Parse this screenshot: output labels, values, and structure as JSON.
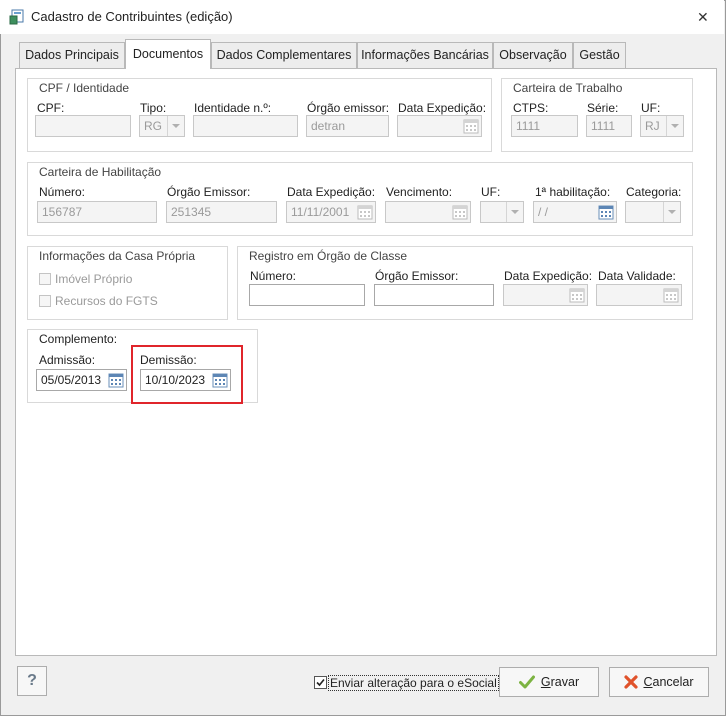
{
  "window": {
    "title": "Cadastro de Contribuintes (edição)",
    "close_glyph": "✕"
  },
  "tabs": [
    {
      "label": "Dados Principais",
      "active": false
    },
    {
      "label": "Documentos",
      "active": true
    },
    {
      "label": "Dados Complementares",
      "active": false
    },
    {
      "label": "Informações Bancárias",
      "active": false
    },
    {
      "label": "Observação",
      "active": false
    },
    {
      "label": "Gestão",
      "active": false
    }
  ],
  "cpf_identidade": {
    "title": "CPF / Identidade",
    "cpf_label": "CPF:",
    "cpf_value": "",
    "tipo_label": "Tipo:",
    "tipo_value": "RG",
    "identidade_label": "Identidade n.º:",
    "identidade_value": "",
    "orgao_label": "Órgão emissor:",
    "orgao_value": "detran",
    "data_label": "Data Expedição:",
    "data_value": ""
  },
  "carteira_trabalho": {
    "title": "Carteira de Trabalho",
    "ctps_label": "CTPS:",
    "ctps_value": "1111",
    "serie_label": "Série:",
    "serie_value": "1111",
    "uf_label": "UF:",
    "uf_value": "RJ"
  },
  "carteira_habilitacao": {
    "title": "Carteira de Habilitação",
    "numero_label": "Número:",
    "numero_value": "156787",
    "orgao_label": "Órgão Emissor:",
    "orgao_value": "251345",
    "data_label": "Data Expedição:",
    "data_value": "11/11/2001",
    "vencimento_label": "Vencimento:",
    "vencimento_value": "",
    "uf_label": "UF:",
    "uf_value": "",
    "primeira_label": "1ª habilitação:",
    "primeira_value": " / /",
    "categoria_label": "Categoria:",
    "categoria_value": ""
  },
  "casa_propria": {
    "title": "Informações da Casa Própria",
    "imovel_label": "Imóvel Próprio",
    "fgts_label": "Recursos do FGTS"
  },
  "orgao_classe": {
    "title": "Registro em Órgão de Classe",
    "numero_label": "Número:",
    "numero_value": "",
    "orgao_label": "Órgão Emissor:",
    "orgao_value": "",
    "data_exp_label": "Data Expedição:",
    "data_exp_value": "",
    "data_val_label": "Data Validade:",
    "data_val_value": ""
  },
  "complemento": {
    "title": "Complemento:",
    "admissao_label": "Admissão:",
    "admissao_value": "05/05/2013",
    "demissao_label": "Demissão:",
    "demissao_value": "10/10/2023"
  },
  "footer": {
    "help_label": "?",
    "esocial_label": "Enviar alteração para o eSocial",
    "esocial_checked": true,
    "gravar_prefix": "",
    "gravar_underlined": "G",
    "gravar_rest": "ravar",
    "cancelar_underlined": "C",
    "cancelar_rest": "ancelar"
  },
  "colors": {
    "highlight": "#e0252b",
    "gravar_check": "#7cb342",
    "cancel_x": "#e0522b"
  }
}
